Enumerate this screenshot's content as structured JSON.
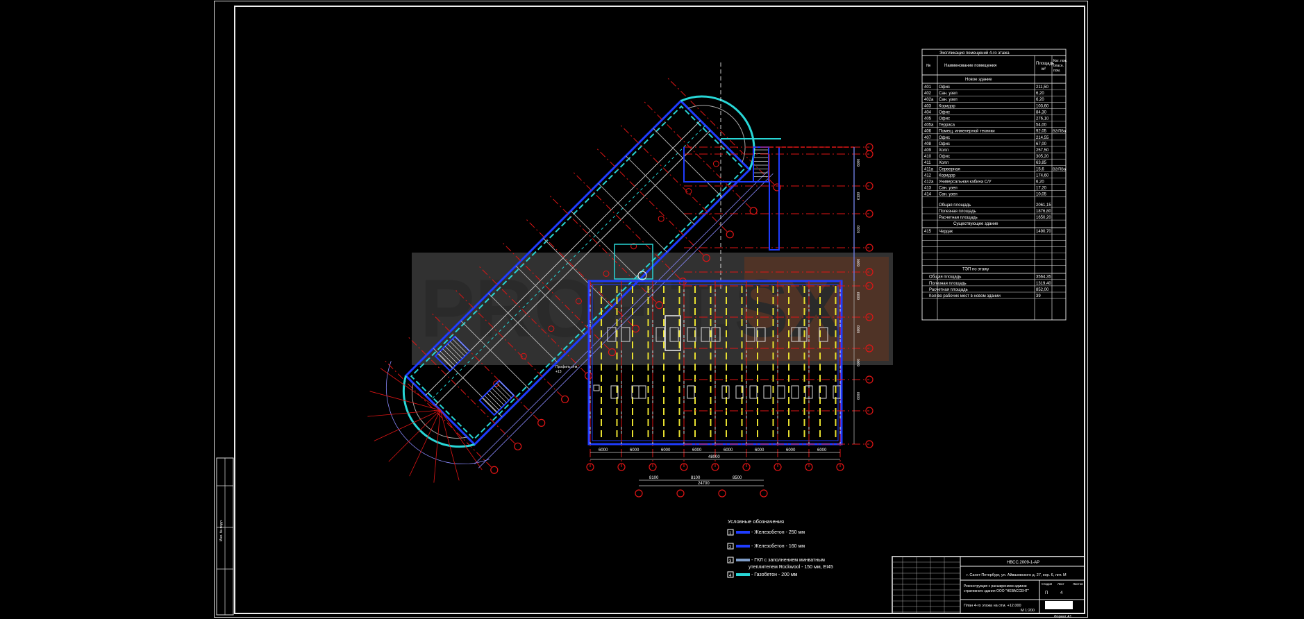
{
  "watermark": "PROFIT.SX",
  "explication": {
    "title": "Экспликация помещений 4-го этажа",
    "headers": [
      "№",
      "Наименование помещения",
      "Площадь м²",
      "Кат. пож. опасн. пом."
    ],
    "section_new": "Новое здание",
    "rows": [
      [
        "401",
        "Офис",
        "211,50",
        ""
      ],
      [
        "402",
        "Сан. узел",
        "6,20",
        ""
      ],
      [
        "402а",
        "Сан. узел",
        "6,20",
        ""
      ],
      [
        "403",
        "Коридор",
        "103,60",
        ""
      ],
      [
        "404",
        "Офис",
        "84,30",
        ""
      ],
      [
        "405",
        "Офис",
        "276,10",
        ""
      ],
      [
        "405а",
        "Терраса",
        "54,00",
        ""
      ],
      [
        "406",
        "Помещ. инженерной техники",
        "92,05",
        "В2/ПВа"
      ],
      [
        "407",
        "Офис",
        "214,55",
        ""
      ],
      [
        "408",
        "Офис",
        "67,00",
        ""
      ],
      [
        "409",
        "Холл",
        "257,50",
        ""
      ],
      [
        "410",
        "Офис",
        "305,20",
        ""
      ],
      [
        "411",
        "Холл",
        "63,85",
        ""
      ],
      [
        "411а",
        "Серверная",
        "15,6",
        "В2/ПВа"
      ],
      [
        "412",
        "Коридор",
        "174,60",
        ""
      ],
      [
        "412а",
        "Универсальная кабина С/У",
        "6,20",
        ""
      ],
      [
        "413",
        "Сан. узел",
        "17,20",
        ""
      ],
      [
        "414",
        "Сан. узел",
        "10,05",
        ""
      ]
    ],
    "totals": [
      [
        "Общая площадь",
        "2061,15"
      ],
      [
        "Полезная площадь",
        "1876,80"
      ],
      [
        "Расчетная площадь",
        "1650,20"
      ]
    ],
    "section_existing": "Существующее здание",
    "existing_rows": [
      [
        "415",
        "Чердак",
        "1490,70",
        ""
      ]
    ],
    "tep_title": "ТЭП по этажу",
    "tep_rows": [
      [
        "Общая площадь",
        "3564,35"
      ],
      [
        "Полезная площадь",
        "1319,40"
      ],
      [
        "Расчетная площадь",
        "852,00"
      ],
      [
        "Кол-во рабочих мест в новом здании",
        "39"
      ]
    ]
  },
  "legend": {
    "title": "Условные обозначения",
    "items": [
      {
        "num": "1",
        "text": "- Железобетон - 250 мм",
        "color": "#1f3cff"
      },
      {
        "num": "2",
        "text": "- Железобетон - 160 мм",
        "color": "#1f3cff"
      },
      {
        "num": "3",
        "text": "- ГКЛ с заполнением минватным",
        "text2": "утеплителем Rockwool - 150 мм, EI45",
        "color": "#7f9dc8"
      },
      {
        "num": "4",
        "text": "- Газобетон - 200 мм",
        "color": "#28d6d6"
      }
    ]
  },
  "title_block": {
    "code": "НВСС.2009-1-АР",
    "address": "г. Санкт-Петербург, ул. Айвазовского д. 27, кор. 6, лит. М",
    "project": "Реконструкция с расширением административного здания ООО \"НЕВАССЕНТ\"",
    "sheet_title": "План 4-го этажа на отм. +12.000",
    "scale": "М 1:200",
    "stage_label": "Стадия",
    "sheet_label": "Лист",
    "sheets_label": "Листов",
    "stage_value": "П",
    "sheet_value": "4",
    "format": "Формат А1"
  },
  "dims": {
    "row1": [
      "6000",
      "6000",
      "6000",
      "6000",
      "6000",
      "6000",
      "6000",
      "6000"
    ],
    "total": "48000",
    "row2": [
      "8100",
      "8100",
      "8500"
    ],
    "total2": "24700"
  },
  "labels": {
    "elev_label": "Профиль отм.",
    "elev_value": "+13",
    "left_stamp": "Инв. № подл."
  },
  "colors": {
    "wall_blue": "#1f3cff",
    "wall_cyan": "#28d6d6",
    "axis_red": "#e01515",
    "grid_yellow": "#e8e030",
    "text": "#ffffff"
  }
}
